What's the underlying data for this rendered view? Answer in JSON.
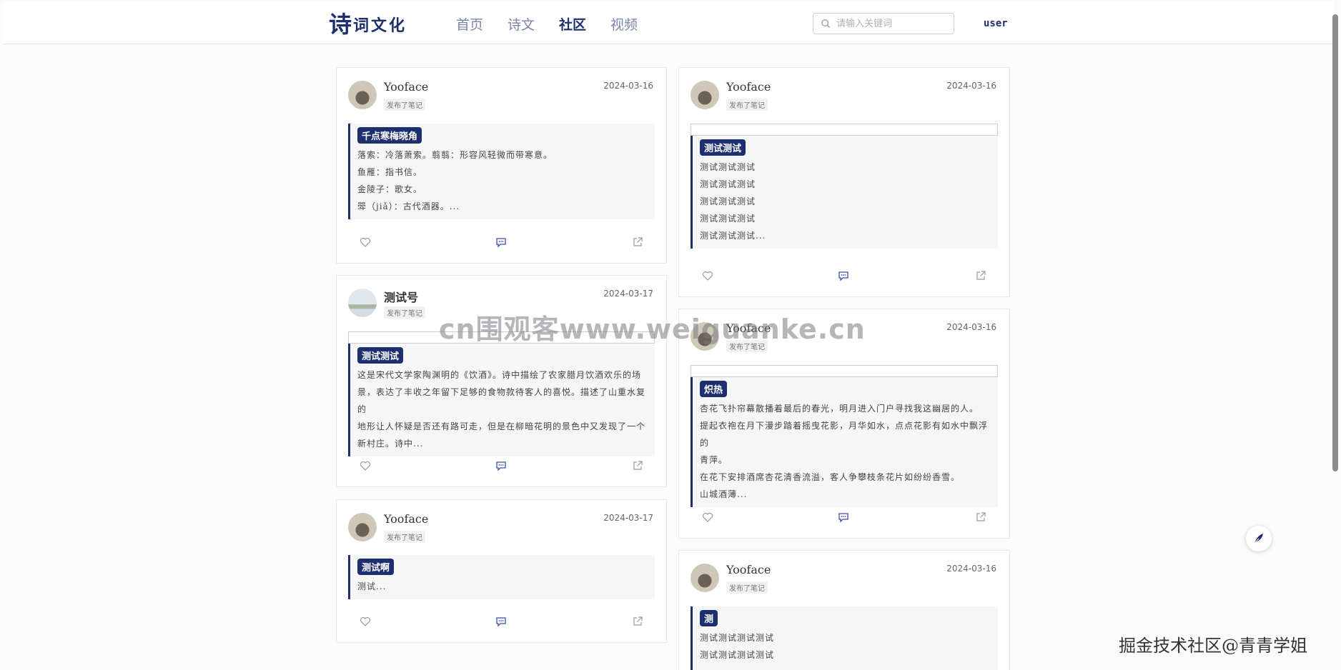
{
  "header": {
    "logo_big": "诗",
    "logo_rest": "词文化",
    "nav": [
      "首页",
      "诗文",
      "社区",
      "视频"
    ],
    "active_nav": "社区",
    "search_placeholder": "请输入关键词",
    "user": "user"
  },
  "colors": {
    "accent": "#1d2f6f",
    "card_body": "#f6f6f6"
  },
  "icons": [
    "search-icon",
    "heart-icon",
    "comment-icon",
    "share-icon",
    "feather-icon"
  ],
  "cards": [
    {
      "user": "Yooface",
      "tag": "发布了笔记",
      "date": "2024-03-16",
      "title": "千点寒梅晓角",
      "lines": [
        "落索：冷落萧索。翦翦：形容风轻微而带寒意。",
        "鱼雁：指书信。",
        "金陵子：歌女。",
        "斝（jiǎ）：古代酒器。..."
      ]
    },
    {
      "user": "测试号",
      "tag": "发布了笔记",
      "date": "2024-03-17",
      "title": "测试测试",
      "lines": [
        "这是宋代文学家陶渊明的《饮酒》。诗中描绘了农家腊月饮酒欢乐的场",
        "景，表达了丰收之年留下足够的食物款待客人的喜悦。描述了山重水复的",
        "地形让人怀疑是否还有路可走，但是在柳暗花明的景色中又发现了一个",
        "新村庄。诗中..."
      ]
    },
    {
      "user": "Yooface",
      "tag": "发布了笔记",
      "date": "2024-03-17",
      "title": "测试啊",
      "lines": [
        "测试..."
      ]
    },
    {
      "user": "Yooface",
      "tag": "发布了笔记",
      "date": "2024-03-16",
      "title": "测试测试",
      "lines": [
        "测试测试测试",
        "测试测试测试",
        "测试测试测试",
        "测试测试测试",
        "测试测试测试..."
      ]
    },
    {
      "user": "Yooface",
      "tag": "发布了笔记",
      "date": "2024-03-16",
      "title": "炽热",
      "lines": [
        "杏花飞扑帘幕散播着最后的春光，明月进入门户寻找我这幽居的人。",
        "提起衣袍在月下漫步踏着摇曳花影，月华如水，点点花影有如水中飘浮的",
        "青萍。",
        "在花下安排酒席杏花清香流溢，客人争攀枝条花片如纷纷香雪。",
        "山城酒薄..."
      ]
    },
    {
      "user": "Yooface",
      "tag": "发布了笔记",
      "date": "2024-03-16",
      "title": "测",
      "lines": [
        "测试测试测试测试",
        "测试测试测试测试"
      ]
    }
  ],
  "watermark": "cn围观客www.weiguanke.cn",
  "footer_watermark": "掘金技术社区@青青学姐"
}
